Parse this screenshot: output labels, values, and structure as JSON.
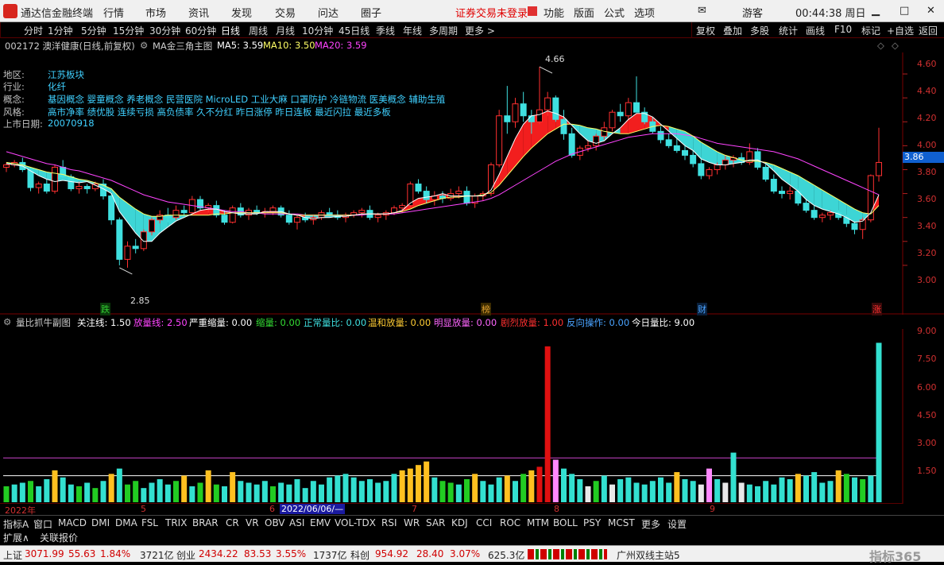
{
  "topbar": {
    "app": "通达信金融终端",
    "menus": [
      "行情",
      "市场",
      "资讯",
      "发现",
      "交易",
      "问达",
      "圈子"
    ],
    "warning": "证券交易未登录",
    "func_menus": [
      "功能",
      "版面",
      "公式",
      "选项"
    ],
    "user": "游客",
    "clock": "00:44:38 周日"
  },
  "periods": [
    "分时",
    "1分钟",
    "5分钟",
    "15分钟",
    "30分钟",
    "60分钟",
    "日线",
    "周线",
    "月线",
    "10分钟",
    "45日线",
    "季线",
    "年线",
    "多周期",
    "更多 >"
  ],
  "active_period": "日线",
  "right_tools": [
    "复权",
    "叠加",
    "多股",
    "统计",
    "画线",
    "F10",
    "标记",
    "+自选",
    "返回"
  ],
  "stock": {
    "code_name": "002172 澳洋健康(日线,前复权)",
    "ma_title": "MA金三角主图",
    "ma5": "MA5: 3.59",
    "ma10": "MA10: 3.50",
    "ma20": "MA20: 3.59"
  },
  "info": {
    "region_label": "地区:",
    "region": "江苏板块",
    "industry_label": "行业:",
    "industry": "化纤",
    "concept_label": "概念:",
    "concept": "基因概念 婴童概念 养老概念 民营医院 MicroLED 工业大麻 口罩防护 冷链物流 医美概念 辅助生殖",
    "style_label": "风格:",
    "style": "高市净率 绩优股 连续亏损 高负债率 久不分红 昨日涨停 昨日连板 最近闪拉 最近多板",
    "listing_label": "上市日期:",
    "listing": "20070918"
  },
  "price_axis": {
    "labels": [
      "4.60",
      "4.40",
      "4.20",
      "4.00",
      "3.80",
      "3.60",
      "3.40",
      "3.20",
      "3.00"
    ],
    "current": "3.86",
    "high_mark": "4.66",
    "low_mark": "2.85"
  },
  "event_marks": [
    {
      "text": "跌",
      "color": "#33cc33"
    },
    {
      "text": "榜",
      "color": "#e0a030"
    },
    {
      "text": "财",
      "color": "#4aa3ff"
    },
    {
      "text": "涨",
      "color": "#ff3030"
    }
  ],
  "indicator": {
    "title": "量比抓牛副图",
    "watch": "关注线: 1.50",
    "expand": "放量线: 2.50",
    "severe_shrink": "严重缩量: 0.00",
    "shrink": "缩量: 0.00",
    "normal": "正常量比: 0.00",
    "mild": "温和放量: 0.00",
    "obvious": "明显放量: 0.00",
    "violent": "剧烈放量: 1.00",
    "reverse": "反向操作: 0.00",
    "today": "今日量比: 9.00"
  },
  "vol_axis": {
    "labels": [
      "9.00",
      "7.50",
      "6.00",
      "4.50",
      "3.00",
      "1.50"
    ]
  },
  "time_axis": {
    "labels": [
      "2022年",
      "5",
      "6",
      "7",
      "8",
      "9"
    ],
    "cursor": "2022/06/06/—"
  },
  "indicator_tabs": [
    "指标A",
    "窗口",
    "MACD",
    "DMI",
    "DMA",
    "FSL",
    "TRIX",
    "BRAR",
    "CR",
    "VR",
    "OBV",
    "ASI",
    "EMV",
    "VOL-TDX",
    "RSI",
    "WR",
    "SAR",
    "KDJ",
    "CCI",
    "ROC",
    "MTM",
    "BOLL",
    "PSY",
    "MCST",
    "更多",
    "设置"
  ],
  "sub_tabs": [
    "扩展∧",
    "关联报价"
  ],
  "status": {
    "sh_name": "上证",
    "sh_val": "3071.99",
    "sh_chg": "55.63",
    "sh_pct": "1.84%",
    "sh_amt": "3721亿",
    "cy_name": "创业",
    "cy_val": "2434.22",
    "cy_chg": "83.53",
    "cy_pct": "3.55%",
    "cy_amt": "1737亿",
    "kc_name": "科创",
    "kc_val": "954.92",
    "kc_chg": "28.40",
    "kc_pct": "3.07%",
    "kc_amt": "625.3亿",
    "server": "广州双线主站5",
    "brand": "指标365"
  },
  "chart_data": {
    "type": "candlestick",
    "ylim": [
      2.8,
      4.7
    ],
    "ohlc": [
      [
        3.82,
        3.86,
        3.78,
        3.84
      ],
      [
        3.84,
        3.88,
        3.82,
        3.86
      ],
      [
        3.86,
        3.9,
        3.78,
        3.8
      ],
      [
        3.8,
        3.82,
        3.62,
        3.65
      ],
      [
        3.65,
        3.7,
        3.6,
        3.68
      ],
      [
        3.68,
        3.72,
        3.6,
        3.62
      ],
      [
        3.62,
        3.84,
        3.6,
        3.82
      ],
      [
        3.82,
        3.88,
        3.72,
        3.74
      ],
      [
        3.74,
        3.76,
        3.62,
        3.64
      ],
      [
        3.64,
        3.7,
        3.6,
        3.66
      ],
      [
        3.66,
        3.68,
        3.6,
        3.64
      ],
      [
        3.64,
        3.7,
        3.62,
        3.68
      ],
      [
        3.68,
        3.72,
        3.55,
        3.58
      ],
      [
        3.58,
        3.6,
        3.34,
        3.38
      ],
      [
        3.38,
        3.4,
        3.0,
        3.05
      ],
      [
        3.05,
        3.2,
        2.98,
        3.16
      ],
      [
        3.16,
        3.22,
        3.1,
        3.14
      ],
      [
        3.14,
        3.3,
        3.12,
        3.28
      ],
      [
        3.28,
        3.4,
        3.25,
        3.38
      ],
      [
        3.38,
        3.46,
        3.35,
        3.42
      ],
      [
        3.42,
        3.48,
        3.36,
        3.4
      ],
      [
        3.4,
        3.5,
        3.38,
        3.46
      ],
      [
        3.46,
        3.5,
        3.4,
        3.44
      ],
      [
        3.44,
        3.58,
        3.42,
        3.55
      ],
      [
        3.55,
        3.58,
        3.46,
        3.48
      ],
      [
        3.48,
        3.52,
        3.44,
        3.5
      ],
      [
        3.5,
        3.54,
        3.4,
        3.42
      ],
      [
        3.42,
        3.46,
        3.34,
        3.36
      ],
      [
        3.36,
        3.5,
        3.35,
        3.48
      ],
      [
        3.48,
        3.52,
        3.4,
        3.42
      ],
      [
        3.42,
        3.48,
        3.38,
        3.46
      ],
      [
        3.46,
        3.5,
        3.42,
        3.44
      ],
      [
        3.44,
        3.48,
        3.4,
        3.45
      ],
      [
        3.45,
        3.5,
        3.42,
        3.48
      ],
      [
        3.48,
        3.5,
        3.4,
        3.42
      ],
      [
        3.42,
        3.46,
        3.34,
        3.36
      ],
      [
        3.36,
        3.42,
        3.3,
        3.4
      ],
      [
        3.4,
        3.44,
        3.36,
        3.38
      ],
      [
        3.38,
        3.42,
        3.34,
        3.4
      ],
      [
        3.4,
        3.46,
        3.38,
        3.44
      ],
      [
        3.44,
        3.48,
        3.4,
        3.42
      ],
      [
        3.42,
        3.46,
        3.38,
        3.4
      ],
      [
        3.4,
        3.44,
        3.36,
        3.42
      ],
      [
        3.42,
        3.46,
        3.4,
        3.44
      ],
      [
        3.44,
        3.48,
        3.4,
        3.46
      ],
      [
        3.46,
        3.5,
        3.38,
        3.4
      ],
      [
        3.4,
        3.44,
        3.36,
        3.42
      ],
      [
        3.42,
        3.46,
        3.38,
        3.44
      ],
      [
        3.44,
        3.5,
        3.42,
        3.48
      ],
      [
        3.48,
        3.52,
        3.44,
        3.5
      ],
      [
        3.5,
        3.7,
        3.48,
        3.68
      ],
      [
        3.68,
        3.72,
        3.6,
        3.62
      ],
      [
        3.62,
        3.66,
        3.52,
        3.55
      ],
      [
        3.55,
        3.62,
        3.5,
        3.58
      ],
      [
        3.58,
        3.62,
        3.52,
        3.56
      ],
      [
        3.56,
        3.64,
        3.54,
        3.6
      ],
      [
        3.6,
        3.66,
        3.56,
        3.62
      ],
      [
        3.62,
        3.66,
        3.5,
        3.52
      ],
      [
        3.52,
        3.6,
        3.48,
        3.58
      ],
      [
        3.58,
        3.62,
        3.54,
        3.6
      ],
      [
        3.6,
        3.86,
        3.58,
        3.84
      ],
      [
        3.84,
        4.3,
        3.82,
        4.25
      ],
      [
        4.25,
        4.5,
        4.1,
        4.2
      ],
      [
        4.2,
        4.4,
        4.15,
        4.35
      ],
      [
        4.35,
        4.45,
        4.2,
        4.25
      ],
      [
        4.25,
        4.3,
        4.1,
        4.2
      ],
      [
        4.2,
        4.66,
        4.18,
        4.3
      ],
      [
        4.3,
        4.45,
        4.25,
        4.4
      ],
      [
        4.4,
        4.42,
        4.2,
        4.22
      ],
      [
        4.22,
        4.3,
        4.05,
        4.1
      ],
      [
        4.1,
        4.15,
        3.9,
        3.92
      ],
      [
        3.92,
        4.0,
        3.88,
        3.98
      ],
      [
        3.98,
        4.05,
        3.95,
        4.0
      ],
      [
        4.0,
        4.1,
        3.96,
        4.08
      ],
      [
        4.08,
        4.2,
        4.05,
        4.15
      ],
      [
        4.15,
        4.3,
        4.12,
        4.28
      ],
      [
        4.28,
        4.35,
        4.2,
        4.25
      ],
      [
        4.25,
        4.4,
        4.22,
        4.36
      ],
      [
        4.36,
        4.58,
        4.3,
        4.28
      ],
      [
        4.28,
        4.32,
        4.18,
        4.2
      ],
      [
        4.2,
        4.24,
        4.1,
        4.12
      ],
      [
        4.12,
        4.16,
        4.02,
        4.05
      ],
      [
        4.05,
        4.1,
        3.98,
        4.0
      ],
      [
        4.0,
        4.08,
        3.94,
        3.96
      ],
      [
        3.96,
        4.02,
        3.88,
        3.92
      ],
      [
        3.92,
        3.96,
        3.82,
        3.85
      ],
      [
        3.85,
        3.9,
        3.72,
        3.75
      ],
      [
        3.75,
        3.82,
        3.72,
        3.8
      ],
      [
        3.8,
        3.86,
        3.76,
        3.84
      ],
      [
        3.84,
        3.92,
        3.8,
        3.88
      ],
      [
        3.88,
        3.92,
        3.82,
        3.9
      ],
      [
        3.9,
        3.94,
        3.84,
        3.86
      ],
      [
        3.86,
        4.02,
        3.84,
        3.95
      ],
      [
        3.95,
        3.98,
        3.8,
        3.82
      ],
      [
        3.82,
        3.86,
        3.7,
        3.72
      ],
      [
        3.72,
        3.76,
        3.6,
        3.62
      ],
      [
        3.62,
        3.66,
        3.56,
        3.6
      ],
      [
        3.6,
        3.66,
        3.55,
        3.62
      ],
      [
        3.62,
        3.64,
        3.5,
        3.52
      ],
      [
        3.52,
        3.56,
        3.44,
        3.46
      ],
      [
        3.46,
        3.5,
        3.38,
        3.4
      ],
      [
        3.4,
        3.44,
        3.36,
        3.42
      ],
      [
        3.42,
        3.46,
        3.38,
        3.44
      ],
      [
        3.44,
        3.46,
        3.38,
        3.4
      ],
      [
        3.4,
        3.42,
        3.32,
        3.35
      ],
      [
        3.35,
        3.38,
        3.26,
        3.3
      ],
      [
        3.3,
        3.4,
        3.22,
        3.38
      ],
      [
        3.38,
        3.76,
        3.36,
        3.75
      ],
      [
        3.75,
        4.15,
        3.7,
        3.86
      ]
    ],
    "ma5": [
      3.85,
      3.84,
      3.83,
      3.79,
      3.75,
      3.72,
      3.7,
      3.71,
      3.7,
      3.69,
      3.7,
      3.67,
      3.64,
      3.6,
      3.45,
      3.36,
      3.27,
      3.2,
      3.2,
      3.27,
      3.32,
      3.37,
      3.4,
      3.43,
      3.46,
      3.47,
      3.47,
      3.45,
      3.44,
      3.43,
      3.43,
      3.43,
      3.45,
      3.45,
      3.45,
      3.43,
      3.42,
      3.4,
      3.39,
      3.4,
      3.4,
      3.41,
      3.41,
      3.42,
      3.43,
      3.43,
      3.43,
      3.43,
      3.44,
      3.46,
      3.52,
      3.56,
      3.57,
      3.58,
      3.6,
      3.58,
      3.58,
      3.58,
      3.58,
      3.58,
      3.63,
      3.76,
      3.91,
      4.06,
      4.18,
      4.25,
      4.26,
      4.29,
      4.27,
      4.24,
      4.17,
      4.1,
      4.04,
      4.02,
      4.04,
      4.1,
      4.15,
      4.22,
      4.27,
      4.27,
      4.24,
      4.18,
      4.12,
      4.06,
      4.0,
      3.96,
      3.89,
      3.86,
      3.84,
      3.84,
      3.85,
      3.86,
      3.88,
      3.88,
      3.85,
      3.79,
      3.72,
      3.67,
      3.62,
      3.55,
      3.5,
      3.47,
      3.45,
      3.43,
      3.4,
      3.36,
      3.37,
      3.44,
      3.59
    ],
    "ma10": [
      3.86,
      3.85,
      3.84,
      3.82,
      3.8,
      3.78,
      3.77,
      3.76,
      3.74,
      3.72,
      3.71,
      3.69,
      3.67,
      3.64,
      3.57,
      3.52,
      3.47,
      3.43,
      3.41,
      3.41,
      3.42,
      3.42,
      3.42,
      3.42,
      3.42,
      3.42,
      3.43,
      3.43,
      3.44,
      3.44,
      3.44,
      3.44,
      3.44,
      3.44,
      3.44,
      3.43,
      3.42,
      3.42,
      3.42,
      3.42,
      3.42,
      3.42,
      3.42,
      3.42,
      3.43,
      3.43,
      3.43,
      3.43,
      3.44,
      3.45,
      3.47,
      3.5,
      3.52,
      3.54,
      3.56,
      3.57,
      3.57,
      3.58,
      3.58,
      3.59,
      3.61,
      3.67,
      3.75,
      3.83,
      3.91,
      3.98,
      4.04,
      4.1,
      4.14,
      4.18,
      4.18,
      4.17,
      4.15,
      4.14,
      4.12,
      4.11,
      4.1,
      4.1,
      4.12,
      4.14,
      4.16,
      4.17,
      4.16,
      4.14,
      4.12,
      4.08,
      4.03,
      3.99,
      3.95,
      3.92,
      3.9,
      3.88,
      3.87,
      3.87,
      3.86,
      3.84,
      3.81,
      3.78,
      3.75,
      3.71,
      3.67,
      3.63,
      3.59,
      3.55,
      3.51,
      3.47,
      3.44,
      3.43,
      3.5
    ],
    "ma20": [
      3.95,
      3.93,
      3.91,
      3.89,
      3.87,
      3.85,
      3.84,
      3.82,
      3.8,
      3.79,
      3.77,
      3.75,
      3.73,
      3.71,
      3.68,
      3.65,
      3.62,
      3.59,
      3.57,
      3.55,
      3.53,
      3.52,
      3.51,
      3.5,
      3.49,
      3.48,
      3.47,
      3.46,
      3.45,
      3.45,
      3.44,
      3.44,
      3.43,
      3.43,
      3.43,
      3.43,
      3.43,
      3.42,
      3.42,
      3.42,
      3.42,
      3.42,
      3.42,
      3.42,
      3.42,
      3.43,
      3.43,
      3.43,
      3.43,
      3.44,
      3.45,
      3.46,
      3.47,
      3.48,
      3.49,
      3.5,
      3.51,
      3.52,
      3.53,
      3.54,
      3.56,
      3.59,
      3.63,
      3.67,
      3.71,
      3.75,
      3.79,
      3.83,
      3.87,
      3.9,
      3.93,
      3.95,
      3.97,
      3.99,
      4.01,
      4.03,
      4.05,
      4.07,
      4.08,
      4.09,
      4.1,
      4.1,
      4.1,
      4.1,
      4.09,
      4.08,
      4.06,
      4.04,
      4.02,
      4.01,
      4.0,
      3.99,
      3.98,
      3.97,
      3.96,
      3.95,
      3.93,
      3.91,
      3.89,
      3.86,
      3.83,
      3.8,
      3.77,
      3.74,
      3.71,
      3.68,
      3.65,
      3.62,
      3.59
    ],
    "vol_ratio": [
      0.9,
      1.0,
      1.1,
      1.2,
      0.9,
      1.3,
      1.8,
      1.4,
      1.0,
      0.9,
      1.1,
      0.8,
      1.2,
      1.6,
      1.9,
      1.0,
      1.2,
      0.8,
      1.1,
      1.3,
      1.0,
      1.2,
      1.5,
      0.9,
      1.1,
      1.8,
      1.0,
      0.9,
      1.7,
      1.2,
      1.1,
      1.0,
      1.2,
      0.9,
      1.1,
      1.0,
      1.3,
      0.8,
      1.2,
      1.0,
      1.4,
      1.5,
      1.6,
      1.4,
      1.2,
      1.3,
      1.1,
      1.2,
      1.6,
      1.8,
      1.9,
      2.1,
      2.3,
      1.4,
      1.2,
      1.1,
      1.0,
      1.3,
      1.6,
      1.2,
      1.0,
      1.4,
      1.5,
      1.2,
      1.6,
      1.8,
      2.0,
      8.8,
      2.4,
      1.9,
      1.6,
      1.3,
      0.9,
      1.2,
      1.5,
      1.0,
      1.3,
      1.4,
      1.1,
      1.0,
      1.2,
      1.4,
      1.1,
      1.7,
      1.3,
      1.2,
      1.0,
      1.9,
      1.3,
      1.1,
      2.8,
      1.1,
      1.0,
      0.9,
      1.2,
      1.0,
      1.4,
      1.3,
      1.6,
      1.5,
      1.7,
      1.1,
      1.2,
      1.8,
      1.6,
      1.4,
      1.3,
      1.5,
      9.0
    ],
    "vol_colors": [
      "g",
      "c",
      "c",
      "g",
      "c",
      "c",
      "y",
      "c",
      "c",
      "g",
      "c",
      "g",
      "c",
      "y",
      "c",
      "g",
      "g",
      "c",
      "c",
      "c",
      "c",
      "g",
      "y",
      "c",
      "g",
      "y",
      "g",
      "c",
      "y",
      "c",
      "c",
      "c",
      "c",
      "g",
      "c",
      "c",
      "c",
      "c",
      "c",
      "c",
      "c",
      "c",
      "c",
      "c",
      "c",
      "c",
      "c",
      "c",
      "c",
      "y",
      "y",
      "y",
      "y",
      "c",
      "g",
      "g",
      "c",
      "g",
      "y",
      "c",
      "c",
      "c",
      "y",
      "c",
      "g",
      "y",
      "r",
      "r",
      "p",
      "c",
      "c",
      "c",
      "w",
      "g",
      "c",
      "w",
      "c",
      "c",
      "c",
      "c",
      "c",
      "c",
      "c",
      "y",
      "c",
      "c",
      "w",
      "p",
      "c",
      "w",
      "c",
      "w",
      "c",
      "c",
      "c",
      "c",
      "c",
      "c",
      "y",
      "c",
      "c",
      "c",
      "c",
      "y",
      "g",
      "c",
      "g",
      "c",
      "c",
      "r"
    ],
    "watch_line": 1.5,
    "expand_line": 2.5,
    "vol_ylim": [
      0,
      9.6
    ]
  }
}
